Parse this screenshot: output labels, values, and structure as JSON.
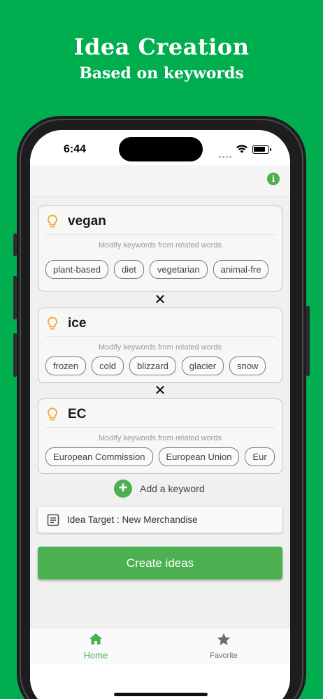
{
  "promo": {
    "title": "Idea Creation",
    "subtitle": "Based on keywords"
  },
  "status_bar": {
    "time": "6:44"
  },
  "keywords": [
    {
      "title": "vegan",
      "hint": "Modify keywords from related words",
      "chips": [
        "plant-based",
        "diet",
        "vegetarian",
        "animal-fre"
      ]
    },
    {
      "title": "ice",
      "hint": "Modify keywords from related words",
      "chips": [
        "frozen",
        "cold",
        "blizzard",
        "glacier",
        "snow"
      ]
    },
    {
      "title": "EC",
      "hint": "Modify keywords from related words",
      "chips": [
        "European Commission",
        "European Union",
        "Eur"
      ]
    }
  ],
  "separator_symbol": "✕",
  "add_keyword_label": "Add a keyword",
  "idea_target_label": "Idea Target : New Merchandise",
  "create_button_label": "Create ideas",
  "tabs": [
    {
      "label": "Home",
      "icon": "home-icon",
      "active": true
    },
    {
      "label": "Favorite",
      "icon": "star-icon",
      "active": false
    }
  ],
  "colors": {
    "background_green": "#00ad4f",
    "accent_green": "#4caf50",
    "bulb_orange": "#f5a623"
  }
}
